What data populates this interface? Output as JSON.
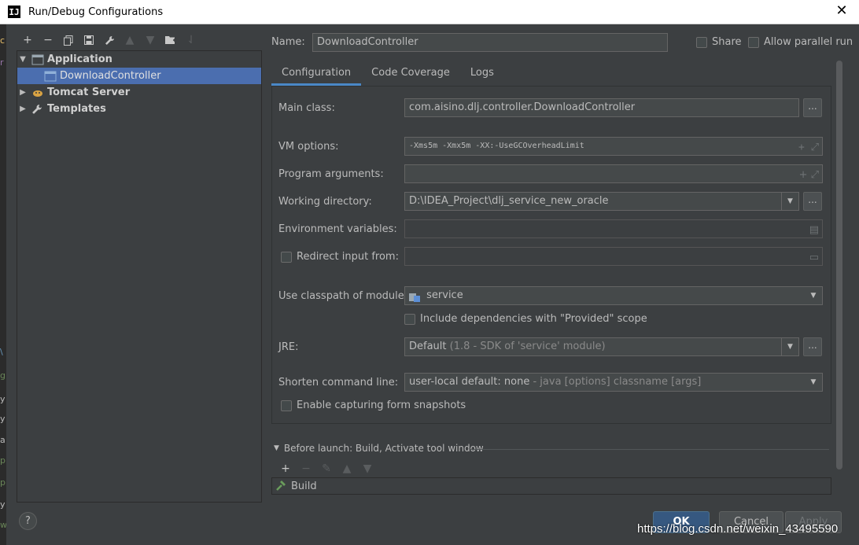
{
  "window": {
    "title": "Run/Debug Configurations",
    "app_icon": "IJ"
  },
  "colors": {
    "accent": "#4b6eaf",
    "background": "#3c3f41",
    "primary_button": "#365880"
  },
  "toolbar": {
    "icons": [
      "add-icon",
      "remove-icon",
      "copy-icon",
      "save-icon",
      "wrench-icon",
      "arrow-up-icon",
      "arrow-down-icon",
      "folder-add-icon",
      "sort-icon"
    ]
  },
  "tree": {
    "items": [
      {
        "label": "Application",
        "expanded": true,
        "icon": "application-icon"
      },
      {
        "label": "DownloadController",
        "selected": true,
        "icon": "class-icon"
      },
      {
        "label": "Tomcat Server",
        "expanded": false,
        "icon": "tomcat-icon"
      },
      {
        "label": "Templates",
        "expanded": false,
        "icon": "wrench-icon"
      }
    ]
  },
  "header": {
    "name_label": "Name:",
    "name_value": "DownloadController",
    "share_label": "Share",
    "parallel_label": "Allow parallel run"
  },
  "tabs": [
    {
      "label": "Configuration",
      "active": true
    },
    {
      "label": "Code Coverage",
      "active": false
    },
    {
      "label": "Logs",
      "active": false
    }
  ],
  "config": {
    "main_class_label": "Main class:",
    "main_class_value": "com.aisino.dlj.controller.DownloadController",
    "vm_options_label": "VM options:",
    "vm_options_value": "-Xms5m -Xmx5m -XX:-UseGCOverheadLimit",
    "program_args_label": "Program arguments:",
    "program_args_value": "",
    "working_dir_label": "Working directory:",
    "working_dir_value": "D:\\IDEA_Project\\dlj_service_new_oracle",
    "env_vars_label": "Environment variables:",
    "env_vars_value": "",
    "redirect_label": "Redirect input from:",
    "redirect_value": "",
    "classpath_label": "Use classpath of module:",
    "classpath_value": "service",
    "include_deps_label": "Include dependencies with \"Provided\" scope",
    "jre_label": "JRE:",
    "jre_value": "Default",
    "jre_detail": "(1.8 - SDK of 'service' module)",
    "shorten_label": "Shorten command line:",
    "shorten_value": "user-local default: none",
    "shorten_detail": "- java [options] classname [args]",
    "snapshots_label": "Enable capturing form snapshots",
    "dots": "..."
  },
  "before_launch": {
    "header": "Before launch: Build, Activate tool window",
    "items": [
      {
        "label": "Build",
        "icon": "hammer-icon"
      }
    ]
  },
  "buttons": {
    "ok": "OK",
    "cancel": "Cancel",
    "apply": "Apply",
    "help": "?"
  },
  "watermark": "https://blog.csdn.net/weixin_43495590"
}
